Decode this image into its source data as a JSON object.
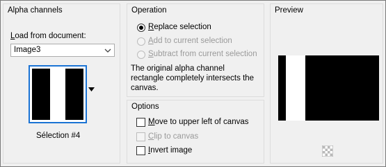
{
  "alpha_channels": {
    "title": "Alpha channels",
    "load_label_pre": "L",
    "load_label_post": "oad from document:",
    "document_value": "Image3",
    "selection_name": "Sélection #4"
  },
  "operation": {
    "title": "Operation",
    "options": [
      {
        "ul": "R",
        "rest": "eplace selection",
        "checked": true,
        "disabled": false
      },
      {
        "ul": "A",
        "rest": "dd to current selection",
        "checked": false,
        "disabled": true
      },
      {
        "ul": "S",
        "rest": "ubtract from current selection",
        "checked": false,
        "disabled": true
      }
    ],
    "description_line1": "The original alpha channel",
    "description_line2": "rectangle completely intersects the",
    "description_line3": "canvas."
  },
  "options": {
    "title": "Options",
    "items": [
      {
        "ul": "M",
        "rest": "ove to upper left of canvas",
        "checked": false,
        "disabled": false
      },
      {
        "ul": "C",
        "rest": "lip to canvas",
        "checked": false,
        "disabled": true
      },
      {
        "ul": "I",
        "rest": "nvert image",
        "checked": false,
        "disabled": false
      }
    ]
  },
  "preview": {
    "title": "Preview"
  },
  "icons": {
    "dropdown": "chevron-down-icon",
    "thumb_menu": "triangle-down-icon",
    "preview_background": "checkerboard-icon"
  }
}
